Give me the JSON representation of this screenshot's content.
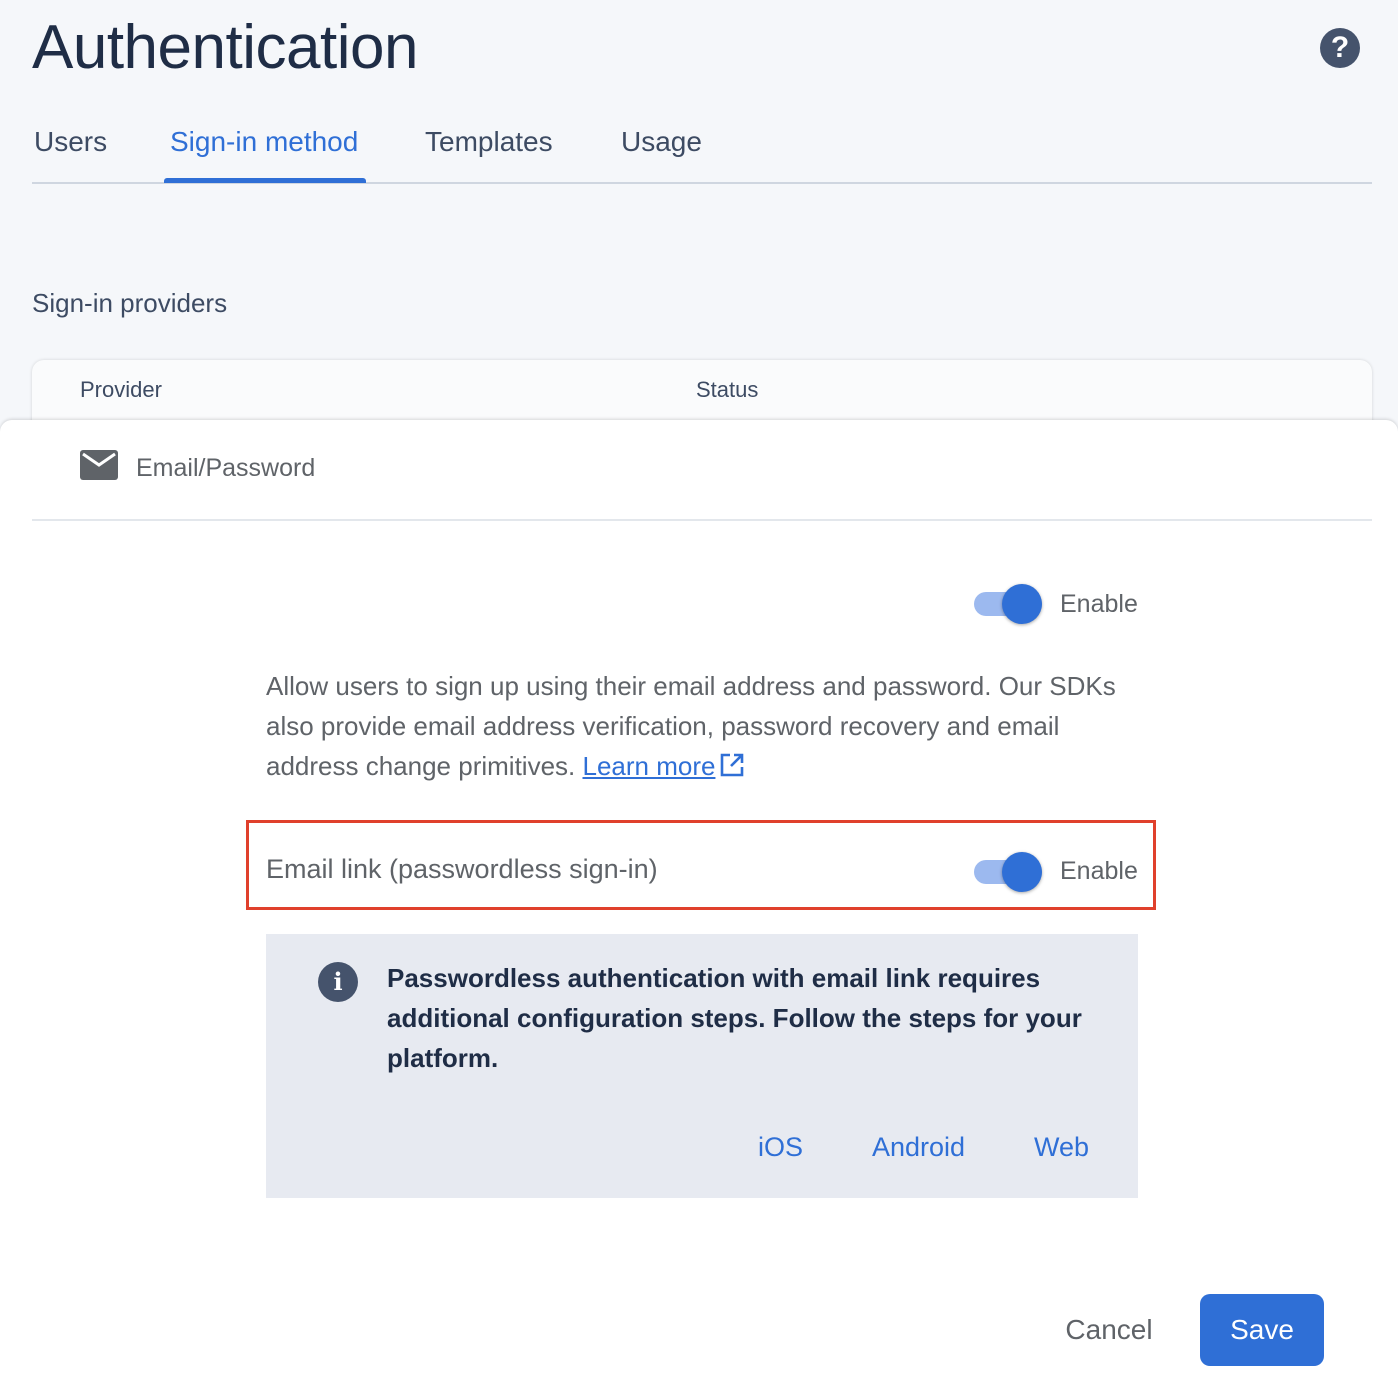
{
  "header": {
    "title": "Authentication",
    "help_icon": "help-circle-icon",
    "help_glyph": "?"
  },
  "tabs": [
    {
      "label": "Users",
      "active": false
    },
    {
      "label": "Sign-in method",
      "active": true
    },
    {
      "label": "Templates",
      "active": false
    },
    {
      "label": "Usage",
      "active": false
    }
  ],
  "section": {
    "title": "Sign-in providers"
  },
  "table": {
    "columns": [
      "Provider",
      "Status"
    ]
  },
  "provider": {
    "name": "Email/Password",
    "icon": "mail-icon",
    "enabled": true,
    "enable_label": "Enable",
    "description": "Allow users to sign up using their email address and password. Our SDKs also provide email address verification, password recovery and email address change primitives.",
    "learn_more": "Learn more"
  },
  "email_link": {
    "label": "Email link (passwordless sign-in)",
    "enabled": true,
    "enable_label": "Enable"
  },
  "info": {
    "icon": "info-icon",
    "glyph": "i",
    "text": "Passwordless authentication with email link requires additional configuration steps. Follow the steps for your platform.",
    "platforms": [
      "iOS",
      "Android",
      "Web"
    ]
  },
  "actions": {
    "cancel_label": "Cancel",
    "save_label": "Save"
  },
  "colors": {
    "accent": "#2f6fd6",
    "highlight_border": "#e0402c",
    "info_background": "#e7eaf1"
  }
}
